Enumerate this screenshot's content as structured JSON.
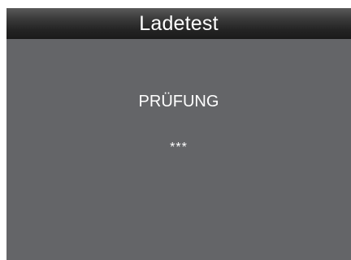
{
  "header": {
    "title": "Ladetest"
  },
  "main": {
    "status": "PRÜFUNG",
    "progress_indicator": "***"
  },
  "colors": {
    "background": "#646568",
    "header": "#242424",
    "text": "#ffffff"
  }
}
